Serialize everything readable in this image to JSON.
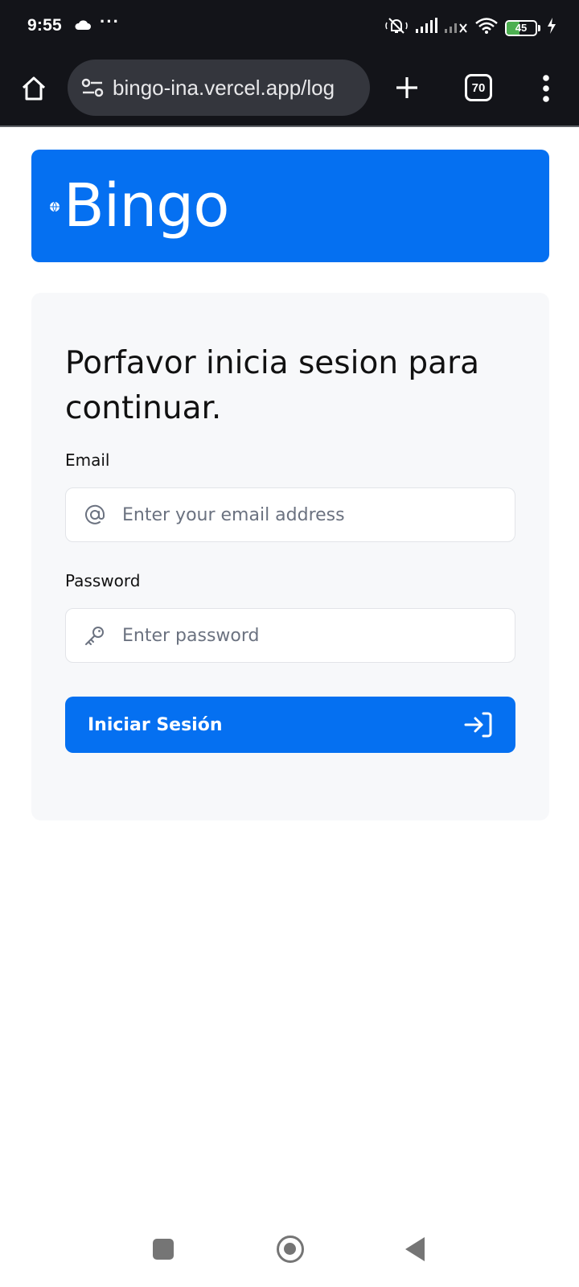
{
  "status_bar": {
    "time": "9:55",
    "more_indicator": "···",
    "battery_level": "45",
    "battery_fraction": 0.45,
    "battery_fill_color": "#4caf50",
    "icons": [
      "cloud-icon",
      "bell-off-icon",
      "signal-icon",
      "signal-no-service-icon",
      "wifi-icon",
      "battery-icon",
      "charging-icon"
    ]
  },
  "browser": {
    "url": "bingo-ina.vercel.app/log",
    "tab_count": "70",
    "icons": [
      "home-icon",
      "tune-icon",
      "plus-icon",
      "tabs-icon",
      "more-vert-icon"
    ]
  },
  "header": {
    "logo_text": "Bingo",
    "brand_color": "#0570f1",
    "icon": "globe-icon"
  },
  "login": {
    "heading": "Porfavor inicia sesion para continuar.",
    "email": {
      "label": "Email",
      "placeholder": "Enter your email address",
      "value": "",
      "icon": "at-sign-icon"
    },
    "password": {
      "label": "Password",
      "placeholder": "Enter password",
      "value": "",
      "icon": "key-icon"
    },
    "submit": {
      "label": "Iniciar Sesión",
      "icon": "login-arrow-icon"
    }
  },
  "nav_bar": {
    "icons": [
      "recent-apps-icon",
      "home-circle-icon",
      "back-icon"
    ]
  }
}
